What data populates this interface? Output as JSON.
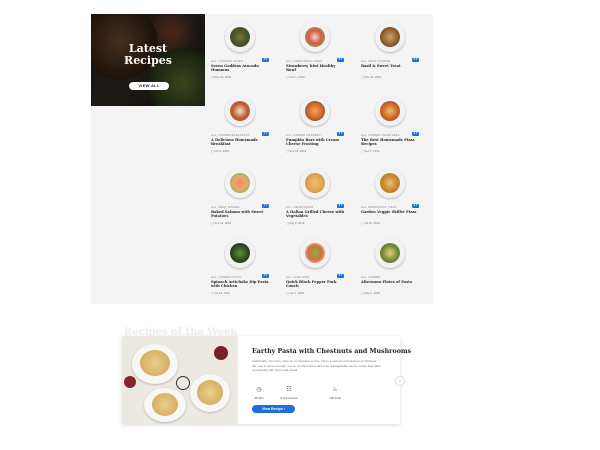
{
  "hero": {
    "title_line1": "Latest",
    "title_line2": "Recipes",
    "button": "VIEW ALL"
  },
  "recipes": [
    {
      "category": "ALL, CHICKEN SIDES",
      "title": "Seven Goddess Avocado Hummus",
      "date": "Dec 20, 2019",
      "badge": "8.0"
    },
    {
      "category": "ALL, CHRISTMAS SIDES",
      "title": "Strawberry Kiwi Healthy Bowl",
      "date": "Nov 1, 2019",
      "badge": "8.0"
    },
    {
      "category": "ALL, MAIN COURSE",
      "title": "Basil & Sweet Treat",
      "date": "Nov 20, 2019",
      "badge": "8.0"
    },
    {
      "category": "ALL, DINNER BREAKFAST",
      "title": "A Delicious Homemade Breakfast",
      "date": "Oct 3, 2019",
      "badge": "8.0"
    },
    {
      "category": "ALL, DINNER DESSERT",
      "title": "Pumpkin Bars with Cream Cheese Frosting",
      "date": "Sep 18, 2019",
      "badge": "8.0"
    },
    {
      "category": "ALL, DINNER VEGETABLE",
      "title": "The Best Homemade Pizza Recipes",
      "date": "Sep 7, 2019",
      "badge": "8.0"
    },
    {
      "category": "ALL, MEAT DINNER",
      "title": "Baked Salmon with Sweet Potatoes",
      "date": "Sep 12, 2019",
      "badge": "8.0"
    },
    {
      "category": "ALL, VEGETARIAN",
      "title": "A Italian Grilled Cheese with Vegetables",
      "date": "Aug 8, 2019",
      "badge": "8.0"
    },
    {
      "category": "ALL, BREAKFAST PIZZA",
      "title": "Garden Veggie Skillet Pizza",
      "date": "Jul 20, 2019",
      "badge": "8.0"
    },
    {
      "category": "ALL, DINNER PASTA",
      "title": "Spinach Artichoke Dip Pasta with Chicken",
      "date": "Jul 18, 2019",
      "badge": "8.0"
    },
    {
      "category": "ALL, SIDE DISH",
      "title": "Quick Black Pepper Pork Lunch",
      "date": "Jun 1, 2019",
      "badge": "8.0"
    },
    {
      "category": "ALL, DINNER",
      "title": "Afternoon Plates of Pasta",
      "date": "May 2, 2019",
      "badge": ""
    }
  ],
  "weekly": {
    "section_title": "Recipes of the Week",
    "title": "Earthy Pasta with Chestnuts and Mushrooms",
    "description": "Individually, hummus, olive oil, or avocado is nice, but to a serious connoisseur of chickpea dip, one is never enough. Let us combine them all for an unforgettable savory snack that pairs wonderfully with warm pita bread.",
    "meta": [
      {
        "icon": "clock-icon",
        "label": "35 Min"
      },
      {
        "icon": "ingredients-icon",
        "label": "5 Ingredients"
      },
      {
        "icon": "calories-icon",
        "label": "180 Kcal"
      }
    ],
    "button": "View Recipe"
  },
  "colors": {
    "accent": "#1f6fd6",
    "panel": "#f4f4f4"
  }
}
